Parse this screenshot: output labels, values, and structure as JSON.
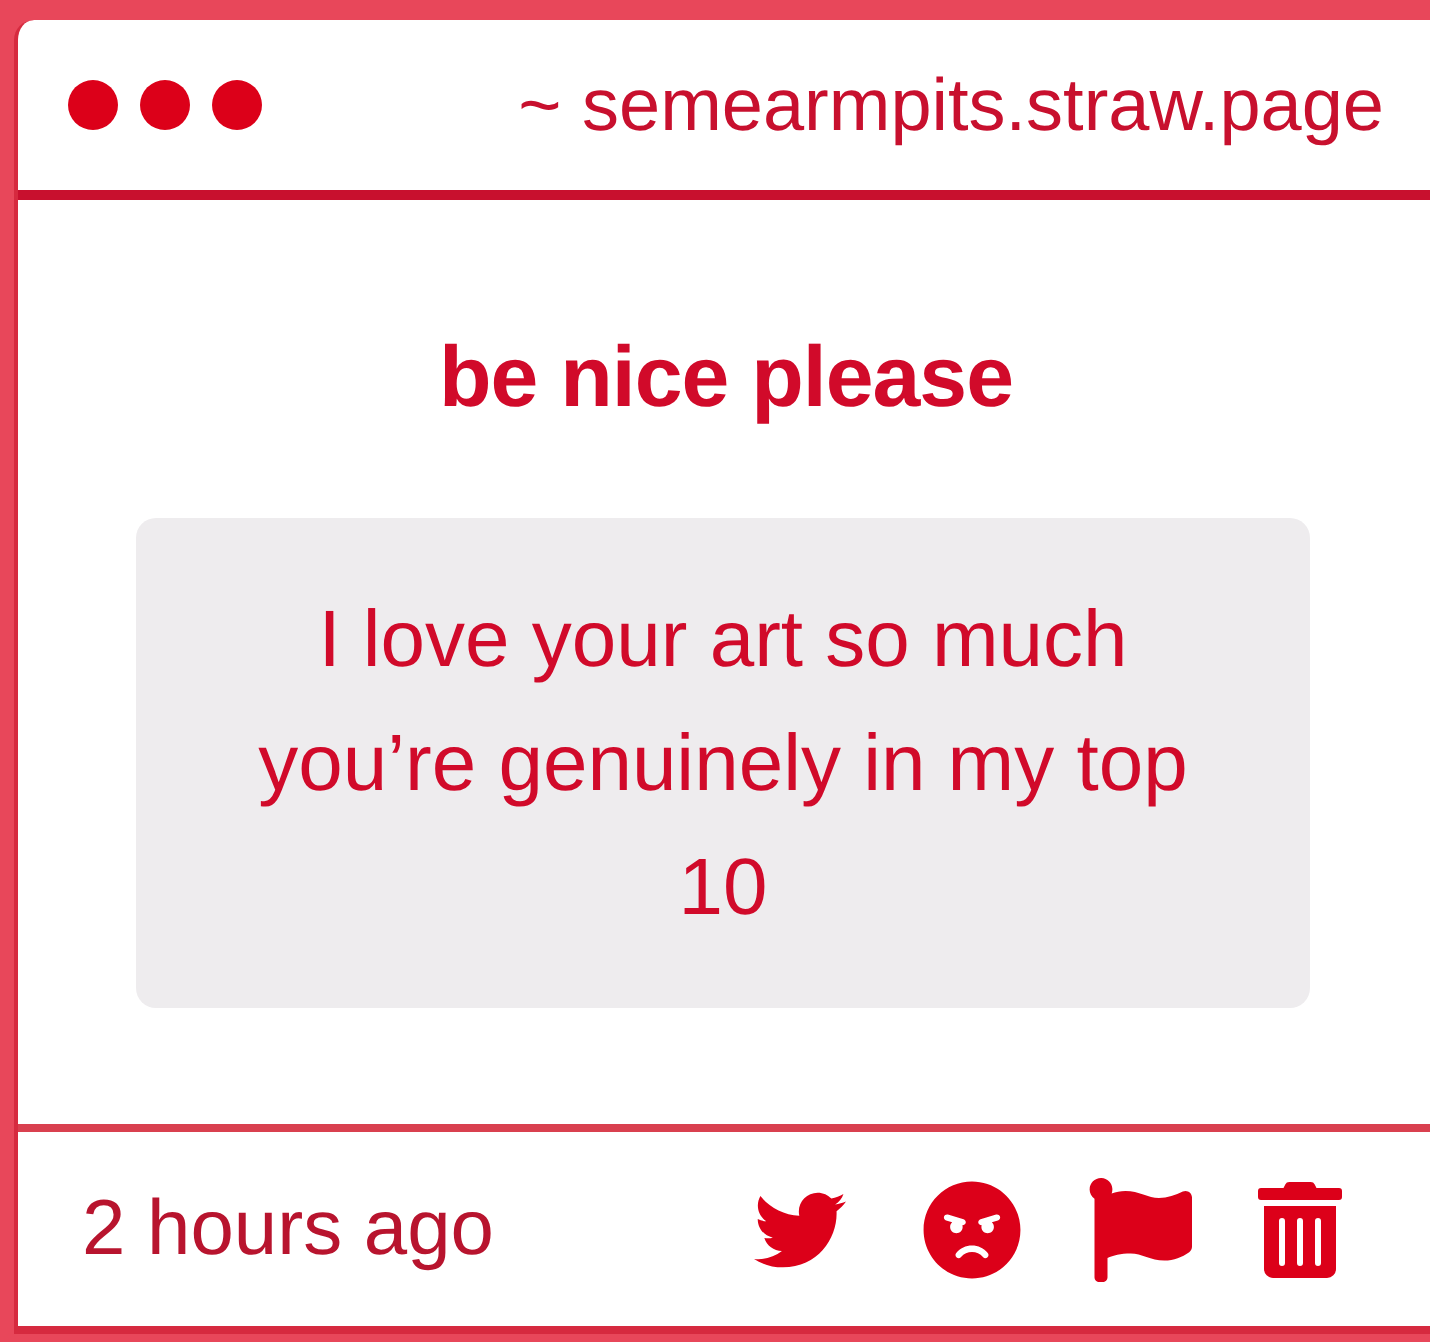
{
  "header": {
    "address": "~ semearmpits.straw.page"
  },
  "prompt": "be nice please",
  "message": "I love your art so much you’re genuinely in my top 10",
  "footer": {
    "time": "2 hours ago"
  }
}
